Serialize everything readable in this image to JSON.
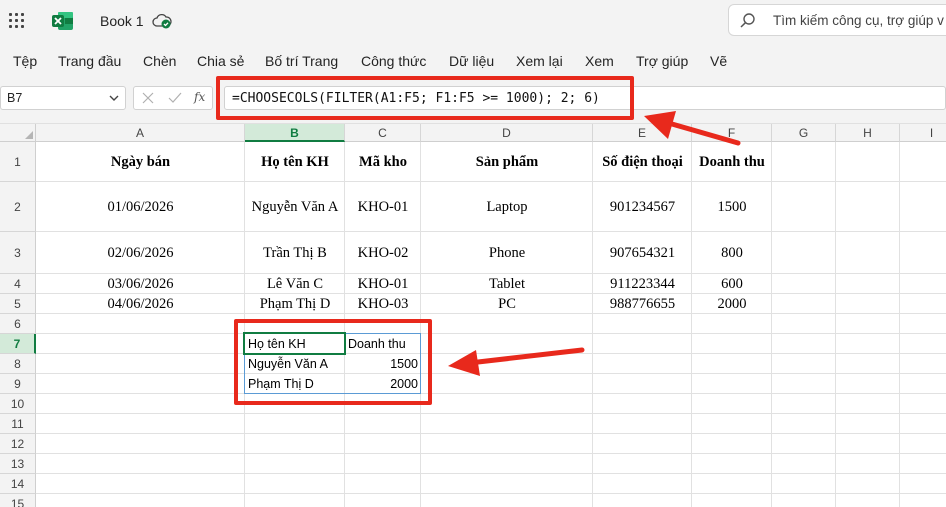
{
  "app": {
    "book_name": "Book 1",
    "search_placeholder": "Tìm kiếm công cụ, trợ giúp v"
  },
  "menu": [
    "Tệp",
    "Trang đầu",
    "Chèn",
    "Chia sẻ",
    "Bố trí Trang",
    "Công thức",
    "Dữ liệu",
    "Xem lại",
    "Xem",
    "Trợ giúp",
    "Vẽ"
  ],
  "formula_bar": {
    "name_box": "B7",
    "fx_label": "fx",
    "formula": "=CHOOSECOLS(FILTER(A1:F5; F1:F5 >= 1000); 2; 6)"
  },
  "columns": [
    "A",
    "B",
    "C",
    "D",
    "E",
    "F",
    "G",
    "H",
    "I"
  ],
  "rows": [
    "1",
    "2",
    "3",
    "4",
    "5",
    "6",
    "7",
    "8",
    "9",
    "10",
    "11",
    "12",
    "13",
    "14",
    "15"
  ],
  "table": {
    "headers": [
      "Ngày bán",
      "Họ tên KH",
      "Mã kho",
      "Sản phẩm",
      "Số điện thoại",
      "Doanh thu"
    ],
    "rows": [
      [
        "01/06/2026",
        "Nguyễn Văn A",
        "KHO-01",
        "Laptop",
        "901234567",
        "1500"
      ],
      [
        "02/06/2026",
        "Trần Thị B",
        "KHO-02",
        "Phone",
        "907654321",
        "800"
      ],
      [
        "03/06/2026",
        "Lê Văn C",
        "KHO-01",
        "Tablet",
        "911223344",
        "600"
      ],
      [
        "04/06/2026",
        "Phạm Thị D",
        "KHO-03",
        "PC",
        "988776655",
        "2000"
      ]
    ]
  },
  "result": {
    "headers": [
      "Họ tên KH",
      "Doanh thu"
    ],
    "rows": [
      [
        "Nguyễn Văn A",
        "1500"
      ],
      [
        "Phạm Thị D",
        "2000"
      ]
    ]
  },
  "colors": {
    "excel_green": "#107c41",
    "annotation_red": "#e8291c",
    "spill_border": "#5b9bd5"
  }
}
